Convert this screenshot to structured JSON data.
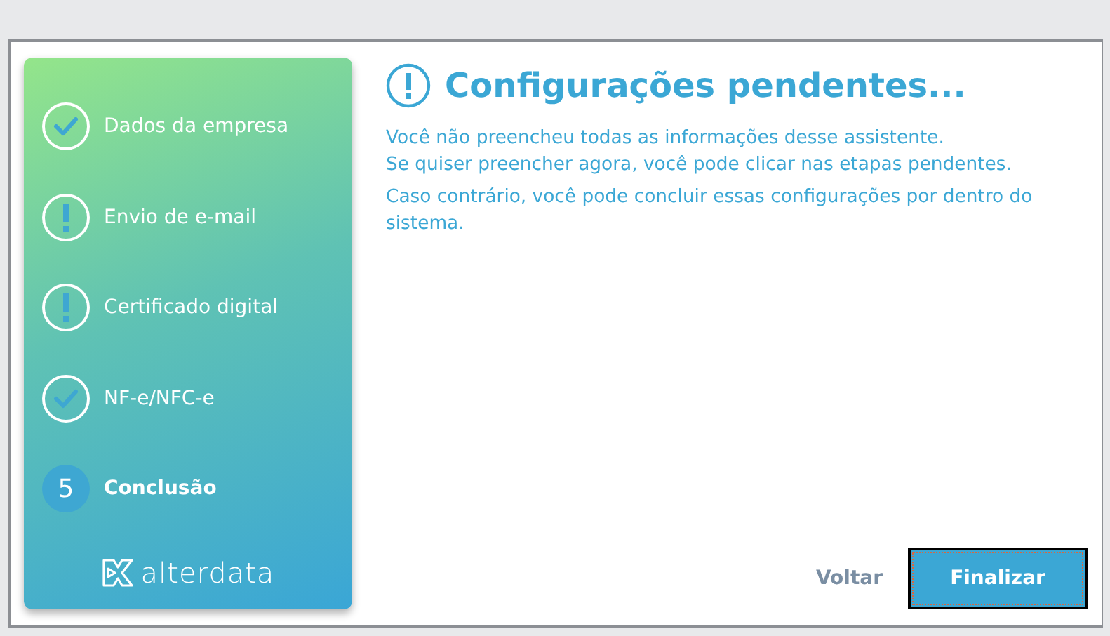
{
  "steps": [
    {
      "label": "Dados da empresa",
      "kind": "done",
      "selected": false
    },
    {
      "label": "Envio de e-mail",
      "kind": "pending",
      "selected": false
    },
    {
      "label": "Certificado digital",
      "kind": "pending",
      "selected": false
    },
    {
      "label": "NF-e/NFC-e",
      "kind": "done",
      "selected": false
    },
    {
      "label": "Conclusão",
      "kind": "current",
      "number": "5",
      "selected": true
    }
  ],
  "logo": "alterdata",
  "title": "Configurações pendentes...",
  "paragraphs": [
    "Você não preencheu todas as informações desse assistente.\nSe quiser preencher agora, você pode clicar nas etapas pendentes.",
    "Caso contrário, você pode concluir essas configurações por dentro do sistema."
  ],
  "buttons": {
    "back": "Voltar",
    "finish": "Finalizar"
  }
}
